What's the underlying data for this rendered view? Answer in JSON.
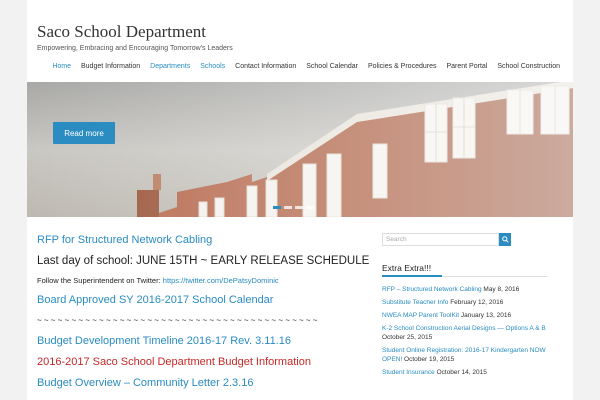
{
  "site": {
    "title": "Saco School Department",
    "tagline": "Empowering, Embracing and Encouraging Tomorrow's Leaders"
  },
  "nav": [
    {
      "label": "Home",
      "accent": true
    },
    {
      "label": "Budget Information",
      "accent": false
    },
    {
      "label": "Departments",
      "accent": true
    },
    {
      "label": "Schools",
      "accent": true
    },
    {
      "label": "Contact Information",
      "accent": false
    },
    {
      "label": "School Calendar",
      "accent": false
    },
    {
      "label": "Policies & Procedures",
      "accent": false
    },
    {
      "label": "Parent Portal",
      "accent": false
    },
    {
      "label": "School Construction",
      "accent": false
    }
  ],
  "hero": {
    "button_label": "Read more",
    "slide_count": 4,
    "active_slide": 1
  },
  "main": {
    "rfp_link": "RFP for Structured Network Cabling",
    "last_day": "Last day of school:  JUNE 15TH ~ EARLY RELEASE SCHEDULE",
    "twitter_text": "Follow the Superintendent on Twitter: ",
    "twitter_link": "https://twitter.com/DePatsyDominic",
    "calendar_link": "Board Approved SY 2016-2017 School Calendar",
    "divider": "~ ~ ~ ~ ~ ~ ~ ~ ~ ~ ~ ~ ~ ~ ~ ~ ~ ~ ~ ~ ~ ~ ~ ~ ~ ~ ~ ~ ~ ~ ~ ~ ~ ~ ~ ~ ~ ~ ~ ~ ~",
    "budget_timeline": "Budget Development Timeline 2016-17 Rev. 3.11.16",
    "budget_info": "2016-2017 Saco School Department Budget Information",
    "budget_overview": "Budget Overview – Community Letter 2.3.16"
  },
  "sidebar": {
    "search_placeholder": "Search",
    "widget_title": "Extra Extra!!!",
    "posts": [
      {
        "title": "RFP – Structured Network Cabling",
        "date": "May 8, 2016"
      },
      {
        "title": "Substitute Teacher Info",
        "date": "February 12, 2016"
      },
      {
        "title": "NWEA MAP Parent ToolKit",
        "date": "January 13, 2016"
      },
      {
        "title": "K-2 School Construction Aerial Designs — Options A & B",
        "date": "October 25, 2015"
      },
      {
        "title": "Student Online Registration: 2016-17 Kindergarten NOW OPEN!",
        "date": "October 19, 2015"
      },
      {
        "title": "Student Insurance",
        "date": "October 14, 2015"
      }
    ]
  },
  "colors": {
    "accent": "#2a8cc1",
    "red": "#c62828",
    "page_bg": "#f2f2f2"
  }
}
